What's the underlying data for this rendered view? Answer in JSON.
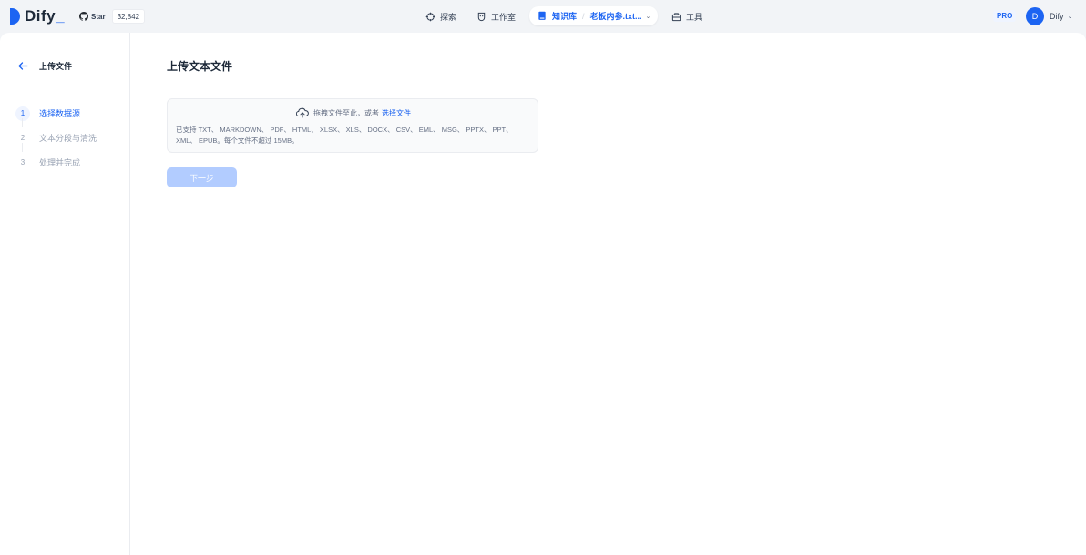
{
  "app": {
    "logo_text": "Dify",
    "brand_color": "#1c64f2"
  },
  "github": {
    "star_label": "Star",
    "star_count": "32,842",
    "icon": "github-icon"
  },
  "nav": {
    "explore": {
      "label": "探索",
      "icon": "explore-icon"
    },
    "studio": {
      "label": "工作室",
      "icon": "studio-icon"
    },
    "knowledge": {
      "label": "知识库",
      "dataset": "老板内参.txt...",
      "icon": "book-icon"
    },
    "tools": {
      "label": "工具",
      "icon": "tools-icon"
    }
  },
  "account": {
    "plan_badge": "PRO",
    "avatar_initial": "D",
    "name": "Dify"
  },
  "sidebar": {
    "title": "上传文件",
    "steps": [
      {
        "num": "1",
        "label": "选择数据源",
        "active": true
      },
      {
        "num": "2",
        "label": "文本分段与清洗",
        "active": false
      },
      {
        "num": "3",
        "label": "处理并完成",
        "active": false
      }
    ]
  },
  "main": {
    "title": "上传文本文件",
    "upload": {
      "prompt": "拖拽文件至此，或者",
      "link": "选择文件",
      "formats": "已支持 TXT、 MARKDOWN、 PDF、 HTML、 XLSX、 XLS、 DOCX、 CSV、 EML、 MSG、 PPTX、 PPT、 XML、 EPUB。每个文件不超过 15MB。"
    },
    "next_button": "下一步"
  }
}
